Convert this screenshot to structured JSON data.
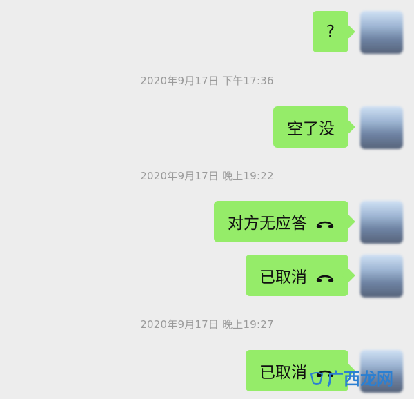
{
  "chat": {
    "messages": [
      {
        "type": "text",
        "text": "?"
      },
      {
        "type": "timestamp",
        "text": "2020年9月17日 下午17:36"
      },
      {
        "type": "text",
        "text": "空了没"
      },
      {
        "type": "timestamp",
        "text": "2020年9月17日 晚上19:22"
      },
      {
        "type": "call",
        "text": "对方无应答",
        "icon": "phone-hangup-icon"
      },
      {
        "type": "call",
        "text": "已取消",
        "icon": "phone-hangup-icon"
      },
      {
        "type": "timestamp",
        "text": "2020年9月17日 晚上19:27"
      },
      {
        "type": "call",
        "text": "已取消",
        "icon": "phone-hangup-icon"
      }
    ]
  },
  "watermark": {
    "text": "广西龙网"
  },
  "colors": {
    "background": "#ededed",
    "bubble": "#95ec69",
    "timestamp": "#9a9a9a",
    "watermark": "#2b7fd1"
  }
}
